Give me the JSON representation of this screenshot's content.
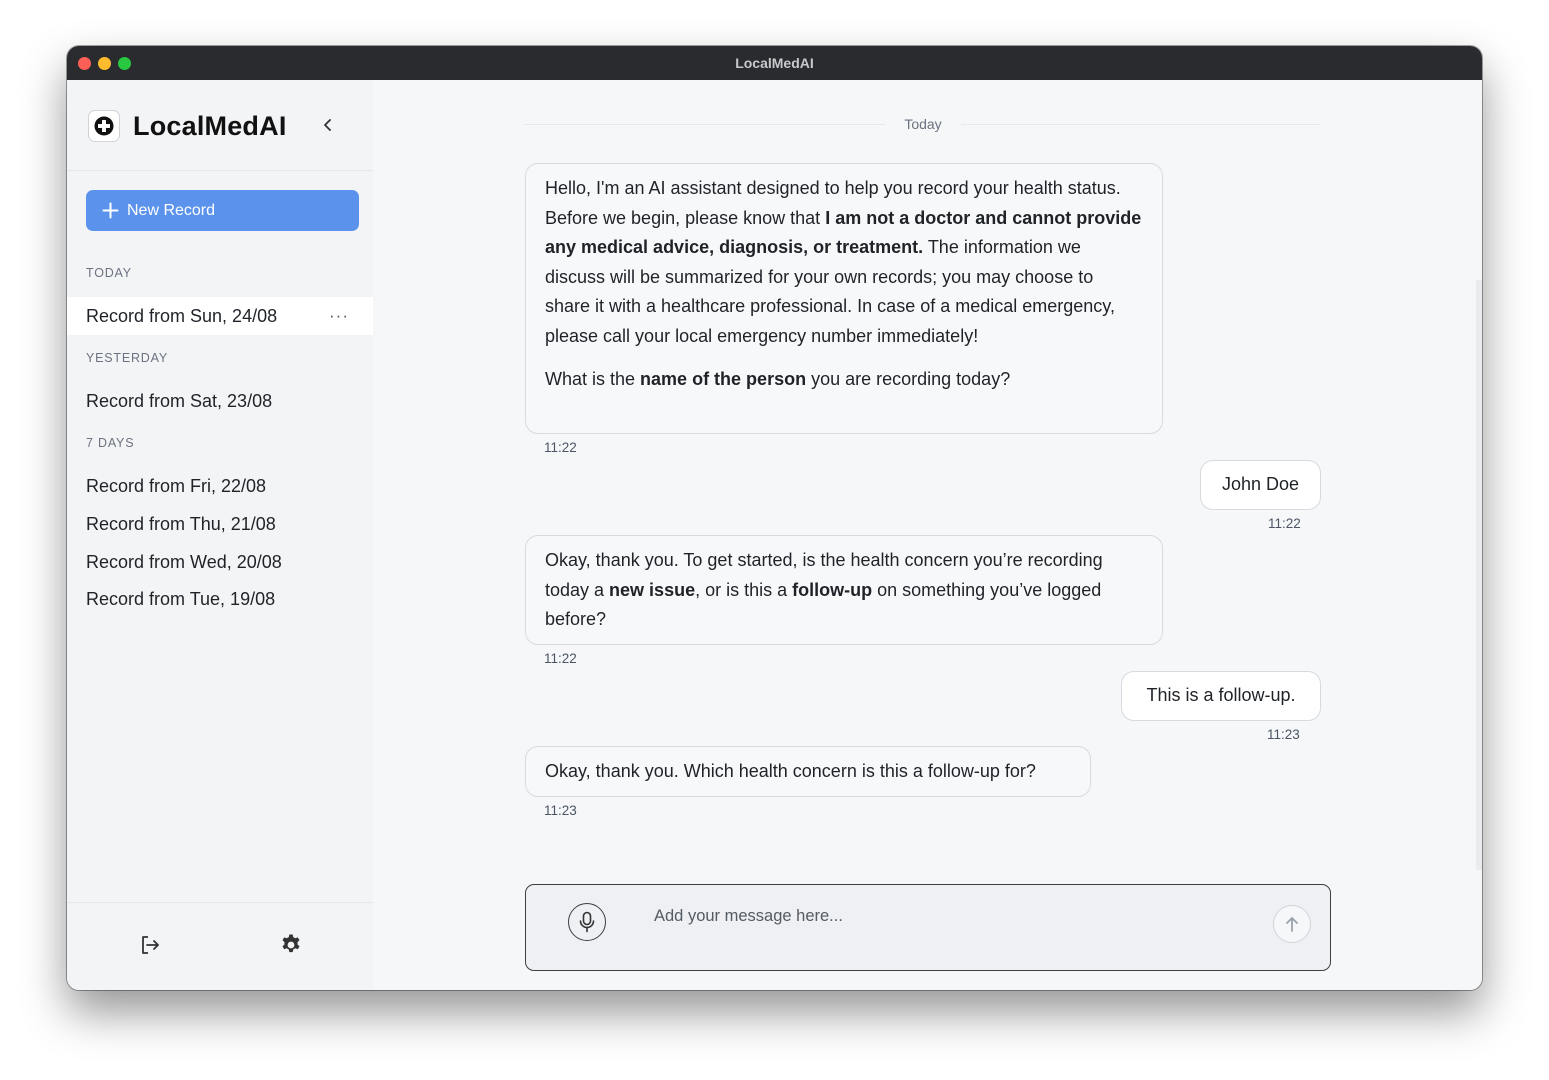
{
  "window": {
    "title": "LocalMedAI"
  },
  "sidebar": {
    "brand": "LocalMedAI",
    "new_record_label": "New Record",
    "sections": {
      "today": "TODAY",
      "yesterday": "YESTERDAY",
      "seven_days": "7 DAYS"
    },
    "items": [
      {
        "label": "Record from Sun, 24/08",
        "more": "···"
      },
      {
        "label": "Record from Sat, 23/08"
      },
      {
        "label": "Record from Fri, 22/08"
      },
      {
        "label": "Record from Thu, 21/08"
      },
      {
        "label": "Record from Wed, 20/08"
      },
      {
        "label": "Record from Tue, 19/08"
      }
    ]
  },
  "chat": {
    "day_label": "Today",
    "messages": [
      {
        "role": "assistant",
        "p1_a": "Hello, I'm an AI assistant designed to help you record your health status. Before we begin, please know that ",
        "p1_b": "I am not a doctor and cannot provide any medical advice, diagnosis, or treatment.",
        "p1_c": " The information we discuss will be summarized for your own records; you may choose to share it with a healthcare professional. In case of a medical emergency, please call your local emergency number immediately!",
        "p2_a": "What is the ",
        "p2_b": "name of the person",
        "p2_c": " you are recording today?",
        "time": "11:22"
      },
      {
        "role": "user",
        "text": "John Doe",
        "time": "11:22"
      },
      {
        "role": "assistant",
        "a": "Okay, thank you. To get started, is the health concern you’re recording today a ",
        "b": "new issue",
        "c": ", or is this a ",
        "d": "follow-up",
        "e": " on something you’ve logged before?",
        "time": "11:22"
      },
      {
        "role": "user",
        "text": "This is a follow-up.",
        "time": "11:23"
      },
      {
        "role": "assistant",
        "text": "Okay, thank you. Which health concern is this a follow-up for?",
        "time": "11:23"
      }
    ],
    "input": {
      "placeholder": "Add your message here..."
    }
  },
  "icons": {
    "logo": "medical-cross-icon",
    "collapse": "chevron-left-icon",
    "new": "plus-icon",
    "logout": "logout-icon",
    "settings": "gear-icon",
    "mic": "microphone-icon",
    "send": "arrow-up-icon"
  },
  "colors": {
    "accent": "#5b93ec",
    "titlebar": "#2a2b2e"
  }
}
